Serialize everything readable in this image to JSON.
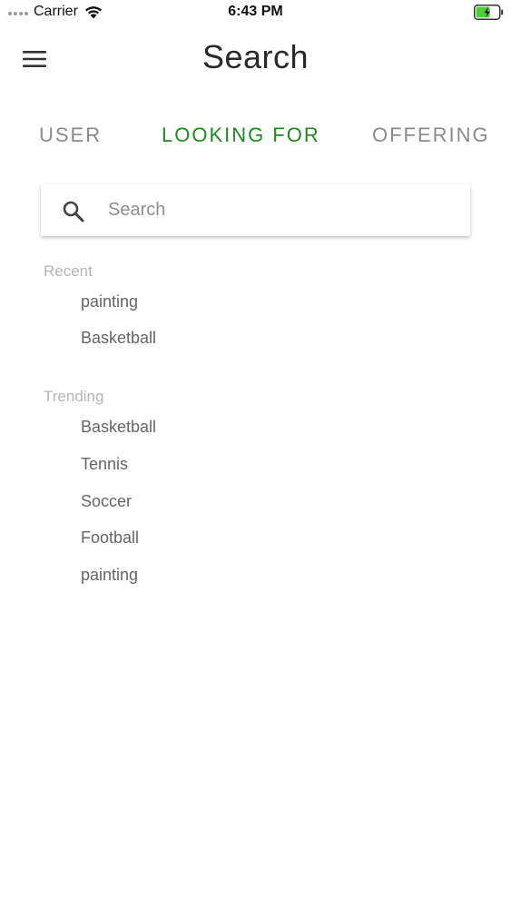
{
  "status_bar": {
    "carrier": "Carrier",
    "time": "6:43 PM",
    "battery_color": "#4cd137"
  },
  "header": {
    "title": "Search",
    "menu_icon": "hamburger-menu-icon"
  },
  "tabs": [
    {
      "label": "USER",
      "active": false
    },
    {
      "label": "LOOKING FOR",
      "active": true
    },
    {
      "label": "OFFERING",
      "active": false
    }
  ],
  "accent_color": "#1f8a1f",
  "search": {
    "placeholder": "Search",
    "value": "",
    "icon": "search-icon"
  },
  "recent": {
    "label": "Recent",
    "items": [
      "painting",
      "Basketball"
    ]
  },
  "trending": {
    "label": "Trending",
    "items": [
      "Basketball",
      "Tennis",
      "Soccer",
      "Football",
      "painting"
    ]
  }
}
